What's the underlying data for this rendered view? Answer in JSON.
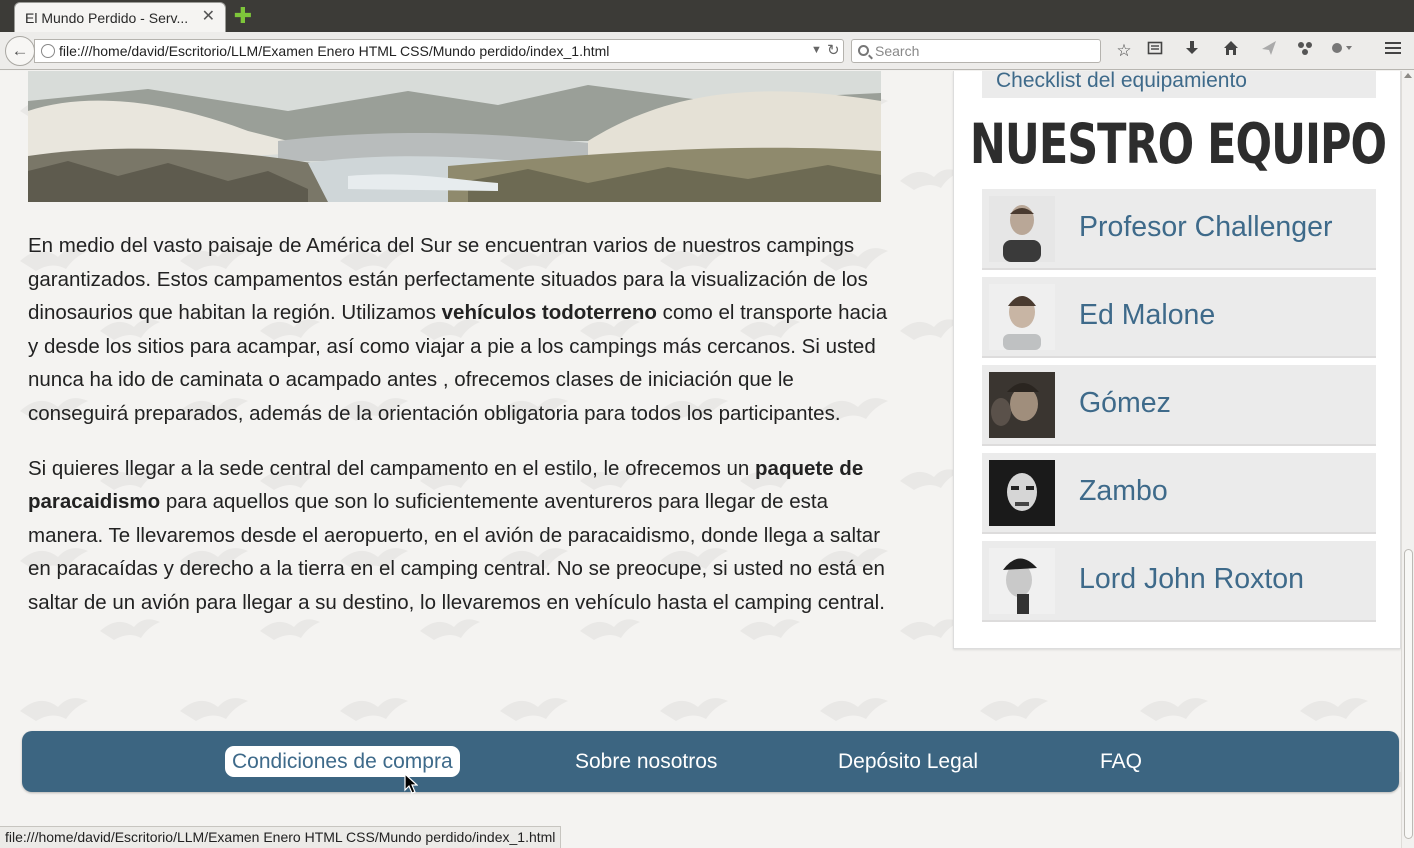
{
  "browser": {
    "tab_title": "El Mundo Perdido - Serv...",
    "tab_close": "✕",
    "new_tab": "✚",
    "url": "file:///home/david/Escritorio/LLM/Examen Enero HTML CSS/Mundo perdido/index_1.html",
    "search_placeholder": "Search",
    "status_url": "file:///home/david/Escritorio/LLM/Examen Enero HTML CSS/Mundo perdido/index_1.html",
    "toolbar_icons": [
      "star-icon",
      "reading-list-icon",
      "download-icon",
      "home-icon",
      "send-icon",
      "share-icon",
      "extension-icon",
      "menu-icon"
    ]
  },
  "article": {
    "p1_a": "En medio del vasto paisaje de América del Sur se encuentran varios de nuestros campings garantizados. Estos campamentos están perfectamente situados para la visualización de los dinosaurios que habitan la región. Utilizamos ",
    "p1_strong": "vehículos todoterreno",
    "p1_b": " como el transporte hacia y desde los sitios para acampar, así como viajar a pie a los campings más cercanos. Si usted nunca ha ido de caminata o acampado antes , ofrecemos clases de iniciación que le conseguirá preparados, además de la orientación obligatoria para todos los participantes.",
    "p2_a": "Si quieres llegar a la sede central del campamento en el estilo, le ofrecemos un ",
    "p2_strong": "paquete de paracaidismo",
    "p2_b": " para aquellos que son lo suficientemente aventureros para llegar de esta manera. Te llevaremos desde el aeropuerto, en el avión de paracaidismo, donde llega a saltar en paracaídas y derecho a la tierra en el camping central. No se preocupe, si usted no está en saltar de un avión para llegar a su destino, lo llevaremos en vehículo hasta el camping central."
  },
  "sidebar": {
    "checklist_link": "Checklist del equipamiento",
    "team_title": "NUESTRO EQUIPO",
    "members": [
      {
        "name": "Profesor Challenger"
      },
      {
        "name": "Ed Malone"
      },
      {
        "name": "Gómez"
      },
      {
        "name": "Zambo"
      },
      {
        "name": "Lord John Roxton"
      }
    ]
  },
  "footer": {
    "links": [
      {
        "label": "Condiciones de compra",
        "active": true
      },
      {
        "label": "Sobre nosotros",
        "active": false
      },
      {
        "label": "Depósito Legal",
        "active": false
      },
      {
        "label": "FAQ",
        "active": false
      }
    ]
  },
  "colors": {
    "accent": "#3c6581",
    "link": "#3e6a8a",
    "page_bg": "#f4f3f1",
    "chrome_dark": "#3c3b37"
  }
}
